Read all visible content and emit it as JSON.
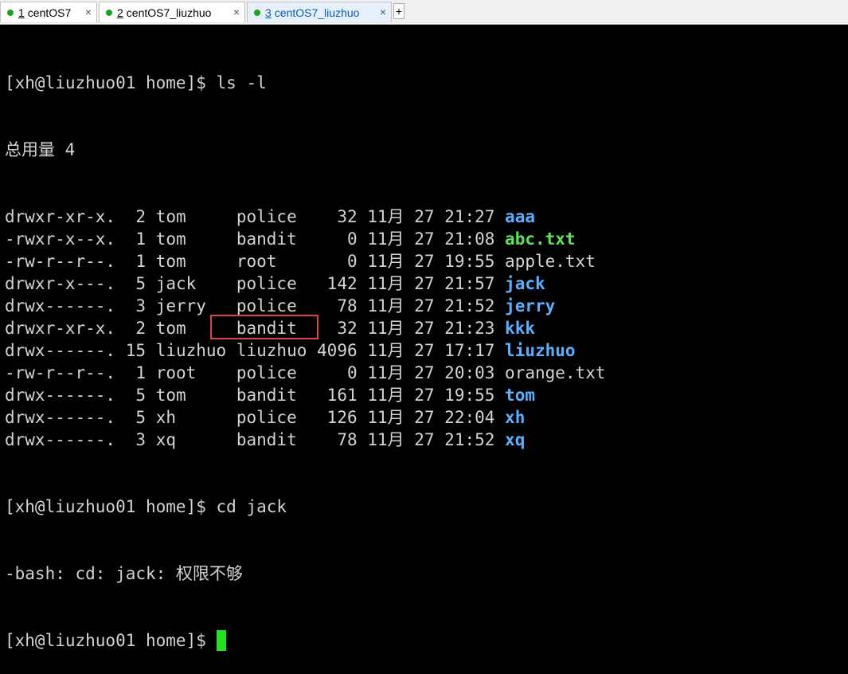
{
  "tabs": [
    {
      "num": "1",
      "label": " centOS7",
      "active": false
    },
    {
      "num": "2",
      "label": " centOS7_liuzhuo",
      "active": false
    },
    {
      "num": "3",
      "label": " centOS7_liuzhuo",
      "active": true
    }
  ],
  "tab_close_glyph": "×",
  "new_tab_glyph": "+",
  "terminal": {
    "prompt": "[xh@liuzhuo01 home]$ ",
    "cmd1": "ls -l",
    "total": "总用量 4",
    "rows": [
      {
        "perm": "drwxr-xr-x.",
        "links": " 2",
        "owner": "tom    ",
        "group": "police ",
        "size": "  32",
        "month": "11月",
        "day": "27",
        "time": "21:27",
        "name": "aaa",
        "type": "dir"
      },
      {
        "perm": "-rwxr-x--x.",
        "links": " 1",
        "owner": "tom    ",
        "group": "bandit ",
        "size": "   0",
        "month": "11月",
        "day": "27",
        "time": "21:08",
        "name": "abc.txt",
        "type": "exec"
      },
      {
        "perm": "-rw-r--r--.",
        "links": " 1",
        "owner": "tom    ",
        "group": "root   ",
        "size": "   0",
        "month": "11月",
        "day": "27",
        "time": "19:55",
        "name": "apple.txt",
        "type": "file"
      },
      {
        "perm": "drwxr-x---.",
        "links": " 5",
        "owner": "jack   ",
        "group": "police ",
        "size": " 142",
        "month": "11月",
        "day": "27",
        "time": "21:57",
        "name": "jack",
        "type": "dir"
      },
      {
        "perm": "drwx------.",
        "links": " 3",
        "owner": "jerry  ",
        "group": "police ",
        "size": "  78",
        "month": "11月",
        "day": "27",
        "time": "21:52",
        "name": "jerry",
        "type": "dir"
      },
      {
        "perm": "drwxr-xr-x.",
        "links": " 2",
        "owner": "tom    ",
        "group": "bandit ",
        "size": "  32",
        "month": "11月",
        "day": "27",
        "time": "21:23",
        "name": "kkk",
        "type": "dir"
      },
      {
        "perm": "drwx------.",
        "links": "15",
        "owner": "liuzhuo",
        "group": "liuzhuo",
        "size": "4096",
        "month": "11月",
        "day": "27",
        "time": "17:17",
        "name": "liuzhuo",
        "type": "dir"
      },
      {
        "perm": "-rw-r--r--.",
        "links": " 1",
        "owner": "root   ",
        "group": "police ",
        "size": "   0",
        "month": "11月",
        "day": "27",
        "time": "20:03",
        "name": "orange.txt",
        "type": "file"
      },
      {
        "perm": "drwx------.",
        "links": " 5",
        "owner": "tom    ",
        "group": "bandit ",
        "size": " 161",
        "month": "11月",
        "day": "27",
        "time": "19:55",
        "name": "tom",
        "type": "dir"
      },
      {
        "perm": "drwx------.",
        "links": " 5",
        "owner": "xh     ",
        "group": "police ",
        "size": " 126",
        "month": "11月",
        "day": "27",
        "time": "22:04",
        "name": "xh",
        "type": "dir"
      },
      {
        "perm": "drwx------.",
        "links": " 3",
        "owner": "xq     ",
        "group": "bandit ",
        "size": "  78",
        "month": "11月",
        "day": "27",
        "time": "21:52",
        "name": "xq",
        "type": "dir"
      }
    ],
    "cmd2": "cd jack",
    "error": "-bash: cd: jack: 权限不够"
  },
  "colors": {
    "directory": "#5aafff",
    "executable": "#5de25d",
    "text": "#d3d3d3",
    "highlight_box": "#e04040",
    "cursor": "#1ee61e",
    "tab_dot": "#1aa31a"
  }
}
